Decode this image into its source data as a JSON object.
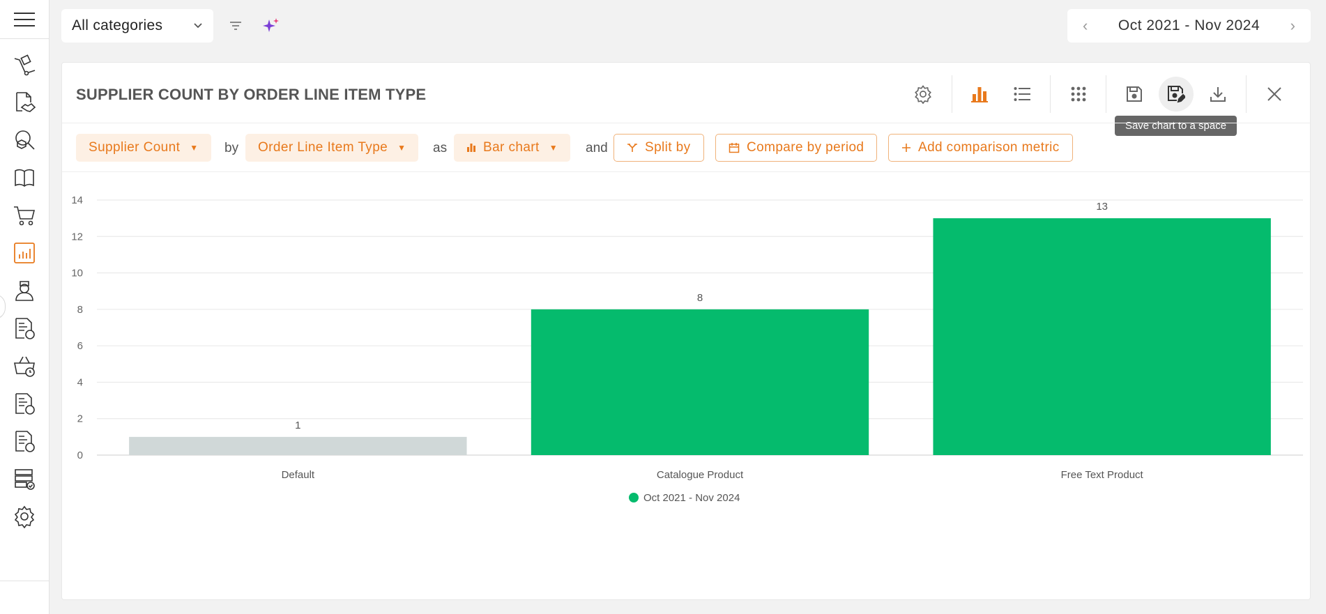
{
  "topbar": {
    "category_select": "All categories",
    "date_range": "Oct 2021 - Nov 2024",
    "filter_icon": "filter-icon",
    "ai_icon": "sparkle-icon"
  },
  "sidebar": {
    "items": [
      "hand-truck-icon",
      "handshake-document-icon",
      "search-box-icon",
      "catalogue-book-icon",
      "cart-icon",
      "analytics-icon",
      "user-icon",
      "invoice-percent-icon",
      "basket-clock-icon",
      "invoice-dollar-icon",
      "invoice-dollar-alt-icon",
      "server-check-icon",
      "settings-icon"
    ],
    "active_item": "analytics-icon"
  },
  "card": {
    "title": "SUPPLIER COUNT BY ORDER LINE ITEM TYPE",
    "tooltip": "Save chart to a space",
    "toolbar": [
      "settings-icon",
      "bar-chart-icon",
      "list-icon",
      "grid-icon",
      "save-icon",
      "save-to-space-icon",
      "download-icon",
      "close-icon"
    ]
  },
  "controls": {
    "metric": "Supplier Count",
    "by": "by",
    "dimension": "Order Line Item Type",
    "as": "as",
    "chart_type": "Bar chart",
    "and": "and",
    "split_by": "Split by",
    "compare_by_period": "Compare by period",
    "add_comparison": "Add comparison metric"
  },
  "colors": {
    "accent": "#e8791c",
    "bar": "#05bb6d",
    "bar_default": "#d0d8d8"
  },
  "chart_data": {
    "type": "bar",
    "categories": [
      "Default",
      "Catalogue Product",
      "Free Text Product"
    ],
    "series": [
      {
        "name": "Oct 2021 - Nov 2024",
        "values": [
          1,
          8,
          13
        ]
      }
    ],
    "data_labels": [
      "1",
      "8",
      "13"
    ],
    "yticks": [
      "0",
      "2",
      "4",
      "6",
      "8",
      "10",
      "12",
      "14"
    ],
    "ylim": [
      0,
      14
    ],
    "grid": true,
    "legend": "bottom-center"
  }
}
